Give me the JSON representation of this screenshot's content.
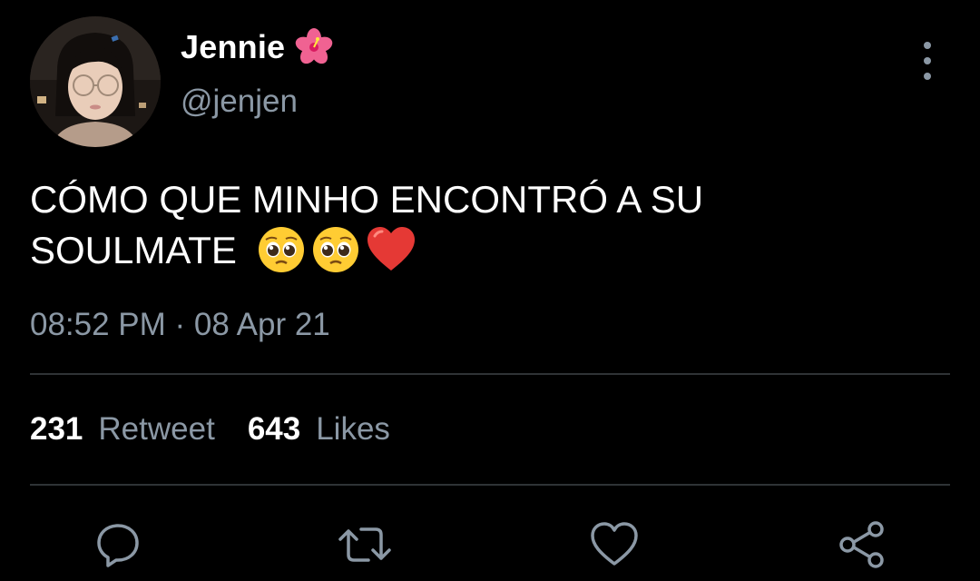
{
  "tweet": {
    "author": {
      "display_name": "Jennie",
      "name_emoji": "hibiscus",
      "handle": "@jenjen"
    },
    "text_line_1": "CÓMO QUE MINHO ENCONTRÓ A SU",
    "text_line_2": "SOULMATE",
    "text_emojis": [
      "pleading-face",
      "pleading-face",
      "red-heart"
    ],
    "timestamp": "08:52 PM · 08 Apr 21",
    "stats": {
      "retweets_count": "231",
      "retweets_label": "Retweet",
      "likes_count": "643",
      "likes_label": "Likes"
    }
  },
  "actions": {
    "reply_icon": "reply-icon",
    "retweet_icon": "retweet-icon",
    "like_icon": "heart-icon",
    "share_icon": "share-icon"
  },
  "colors": {
    "background": "#000000",
    "primary_text": "#ffffff",
    "secondary_text": "#8b98a5",
    "divider": "#2f3336"
  }
}
